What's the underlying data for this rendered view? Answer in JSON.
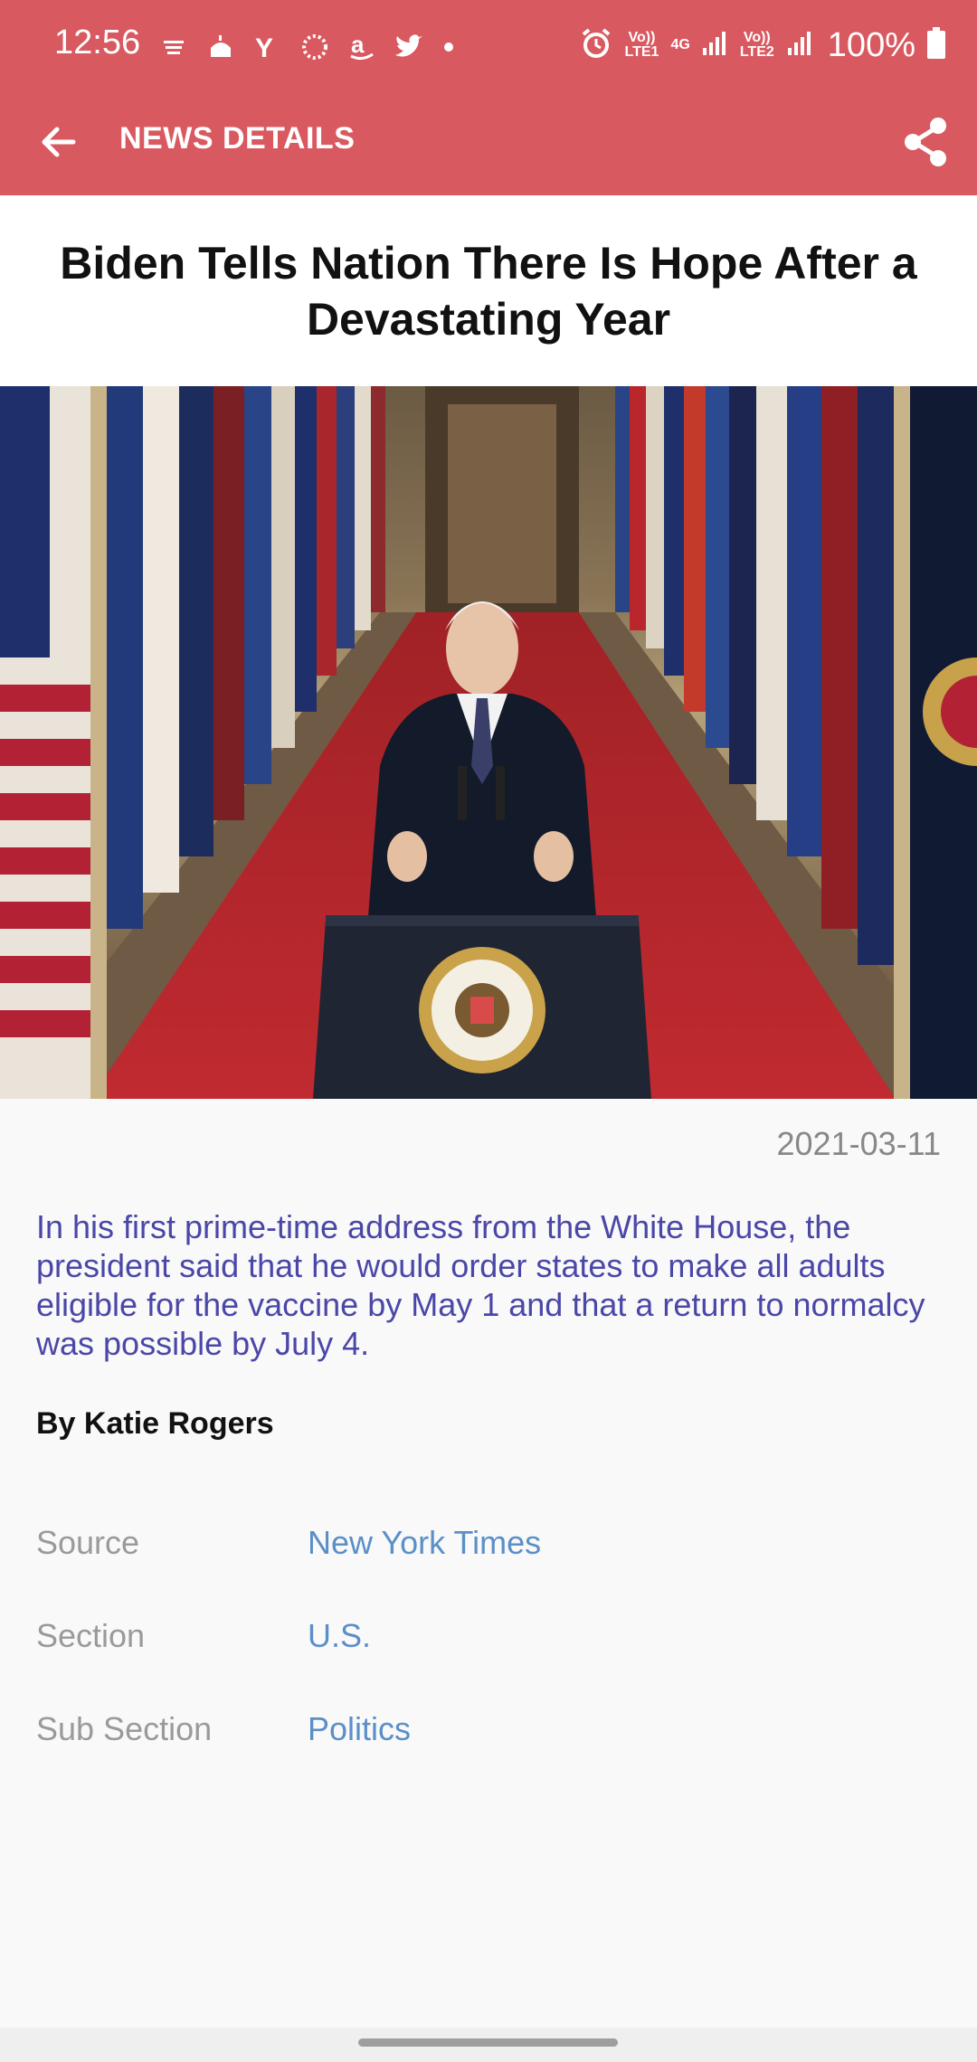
{
  "status_bar": {
    "time": "12:56",
    "notification_icons": [
      "dubai-mall-icon",
      "mosque-icon",
      "yahoo-icon",
      "circle-dots-icon",
      "amazon-icon",
      "twitter-icon"
    ],
    "network": {
      "sim1": "Vo)) LTE1",
      "gen": "4G",
      "sim2": "Vo)) LTE2"
    },
    "battery": "100%"
  },
  "app_bar": {
    "title": "NEWS DETAILS",
    "back_icon": "arrow-back-icon",
    "share_icon": "share-icon"
  },
  "article": {
    "headline": "Biden Tells Nation There Is Hope After a Devastating Year",
    "date": "2021-03-11",
    "summary": "In his first prime-time address from the White House, the president said that he would order states to make all adults eligible for the vaccine by May 1 and that a return to normalcy was possible by July 4.",
    "byline": "By Katie Rogers"
  },
  "meta": [
    {
      "label": "Source",
      "value": "New York Times"
    },
    {
      "label": "Section",
      "value": "U.S."
    },
    {
      "label": "Sub Section",
      "value": "Politics"
    }
  ],
  "colors": {
    "header": "#d95960",
    "summary_text": "#4a47a8",
    "link": "#5b8fc8",
    "label": "#9a9a9a"
  }
}
